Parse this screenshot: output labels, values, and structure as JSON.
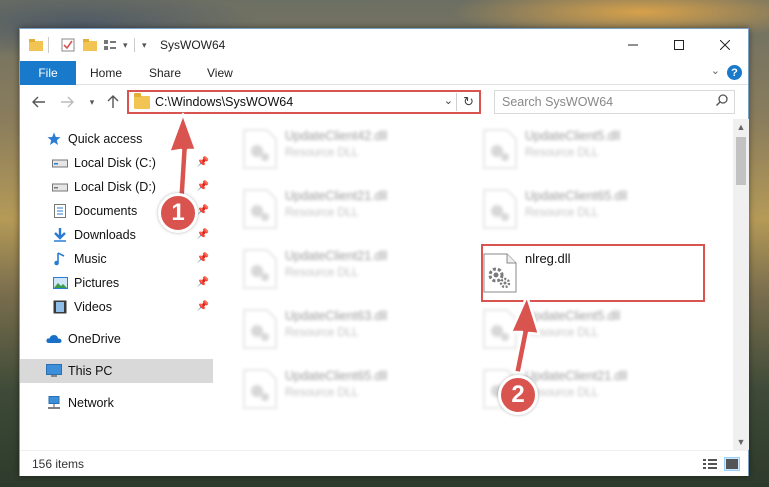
{
  "window": {
    "title": "SysWOW64"
  },
  "ribbon": {
    "tabs": [
      {
        "label": "File"
      },
      {
        "label": "Home"
      },
      {
        "label": "Share"
      },
      {
        "label": "View"
      }
    ],
    "help": "?"
  },
  "address": {
    "path": "C:\\Windows\\SysWOW64",
    "search_placeholder": "Search SysWOW64"
  },
  "sidebar": {
    "items": [
      {
        "label": "Quick access"
      },
      {
        "label": "Local Disk (C:)"
      },
      {
        "label": "Local Disk (D:)"
      },
      {
        "label": "Documents"
      },
      {
        "label": "Downloads"
      },
      {
        "label": "Music"
      },
      {
        "label": "Pictures"
      },
      {
        "label": "Videos"
      },
      {
        "label": "OneDrive"
      },
      {
        "label": "This PC"
      },
      {
        "label": "Network"
      }
    ]
  },
  "files": [
    {
      "name": "UpdateClient42.dll",
      "type": "Resource DLL"
    },
    {
      "name": "UpdateClient5.dll",
      "type": "Resource DLL"
    },
    {
      "name": "UpdateClient21.dll",
      "type": "Resource DLL"
    },
    {
      "name": "UpdateClient65.dll",
      "type": "Resource DLL"
    },
    {
      "name": "UpdateClient21.dll",
      "type": "Resource DLL"
    },
    {
      "name": "nlreg.dll",
      "type": ""
    },
    {
      "name": "UpdateClient63.dll",
      "type": "Resource DLL"
    },
    {
      "name": "UpdateClient5.dll",
      "type": "Resource DLL"
    },
    {
      "name": "UpdateClient65.dll",
      "type": "Resource DLL"
    },
    {
      "name": "UpdateClient21.dll",
      "type": "Resource DLL"
    }
  ],
  "status": {
    "item_count": "156 items"
  },
  "annotations": {
    "step1": "1",
    "step2": "2",
    "color": "#d9534f"
  }
}
